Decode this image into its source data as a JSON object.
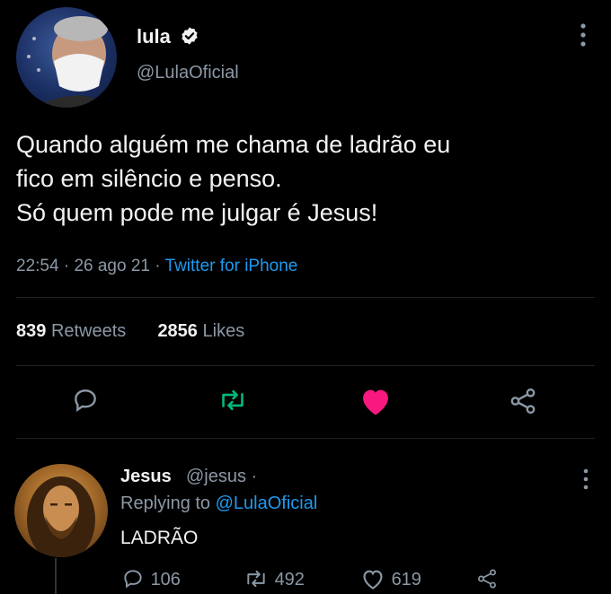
{
  "tweet": {
    "author_name": "lula",
    "author_handle": "@LulaOficial",
    "text_lines": [
      "Quando alguém me chama de ladrão eu",
      "fico em silêncio e penso.",
      "Só quem pode me julgar é Jesus!"
    ],
    "time": "22:54",
    "date": "26 ago 21",
    "source": "Twitter for iPhone",
    "retweets_count": "839",
    "retweets_label": "Retweets",
    "likes_count": "2856",
    "likes_label": "Likes",
    "liked": true
  },
  "reply": {
    "author_name": "Jesus",
    "author_handle": "@jesus",
    "replying_to_prefix": "Replying to",
    "replying_to_handle": "@LulaOficial",
    "text": "LADRÃO",
    "reply_count": "106",
    "retweet_count": "492",
    "like_count": "619"
  },
  "colors": {
    "background": "#000000",
    "link": "#1d9bf0",
    "retweet": "#00ba7c",
    "like": "#f91880",
    "muted": "#8b98a5"
  },
  "icons": [
    "verified-badge-icon",
    "more-options-icon",
    "reply-icon",
    "retweet-icon",
    "like-icon",
    "share-icon"
  ]
}
